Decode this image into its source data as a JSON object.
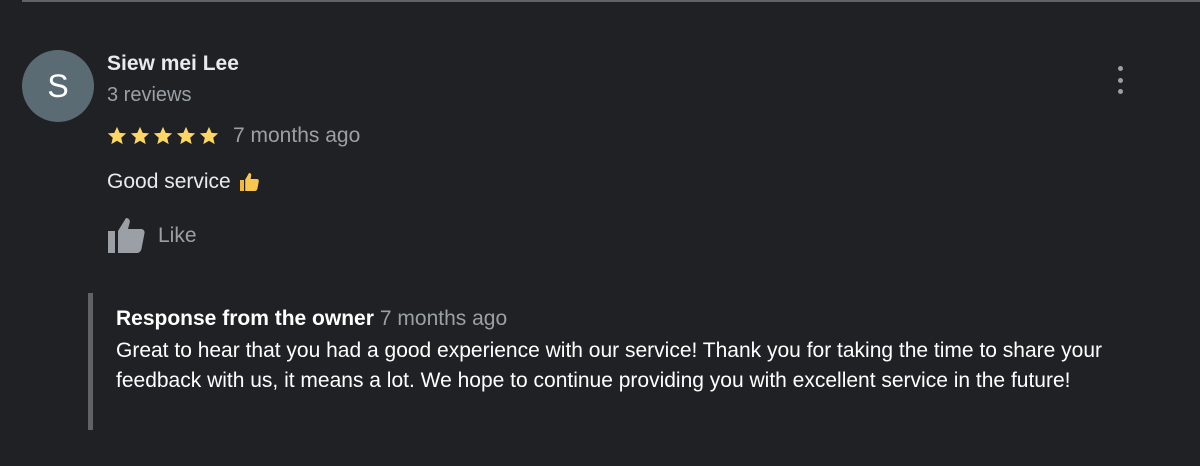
{
  "review": {
    "avatar_letter": "S",
    "author_name": "Siew mei Lee",
    "review_count": "3 reviews",
    "rating": 5,
    "rating_max": 5,
    "date": "7 months ago",
    "text": "Good service",
    "text_emoji": "thumbs-up-emoji",
    "like_label": "Like"
  },
  "owner_response": {
    "title": "Response from the owner",
    "date": "7 months ago",
    "text": "Great to hear that you had a good experience with our service! Thank you for taking the time to share your feedback with us, it means a lot. We hope to continue providing you with excellent service in the future!"
  },
  "icons": {
    "more": "more-vert-icon",
    "like": "thumbs-up-icon",
    "star": "star-icon"
  },
  "colors": {
    "background": "#202124",
    "star": "#fdd663",
    "avatar_bg": "#5b6b73",
    "secondary_text": "#9aa0a6"
  }
}
